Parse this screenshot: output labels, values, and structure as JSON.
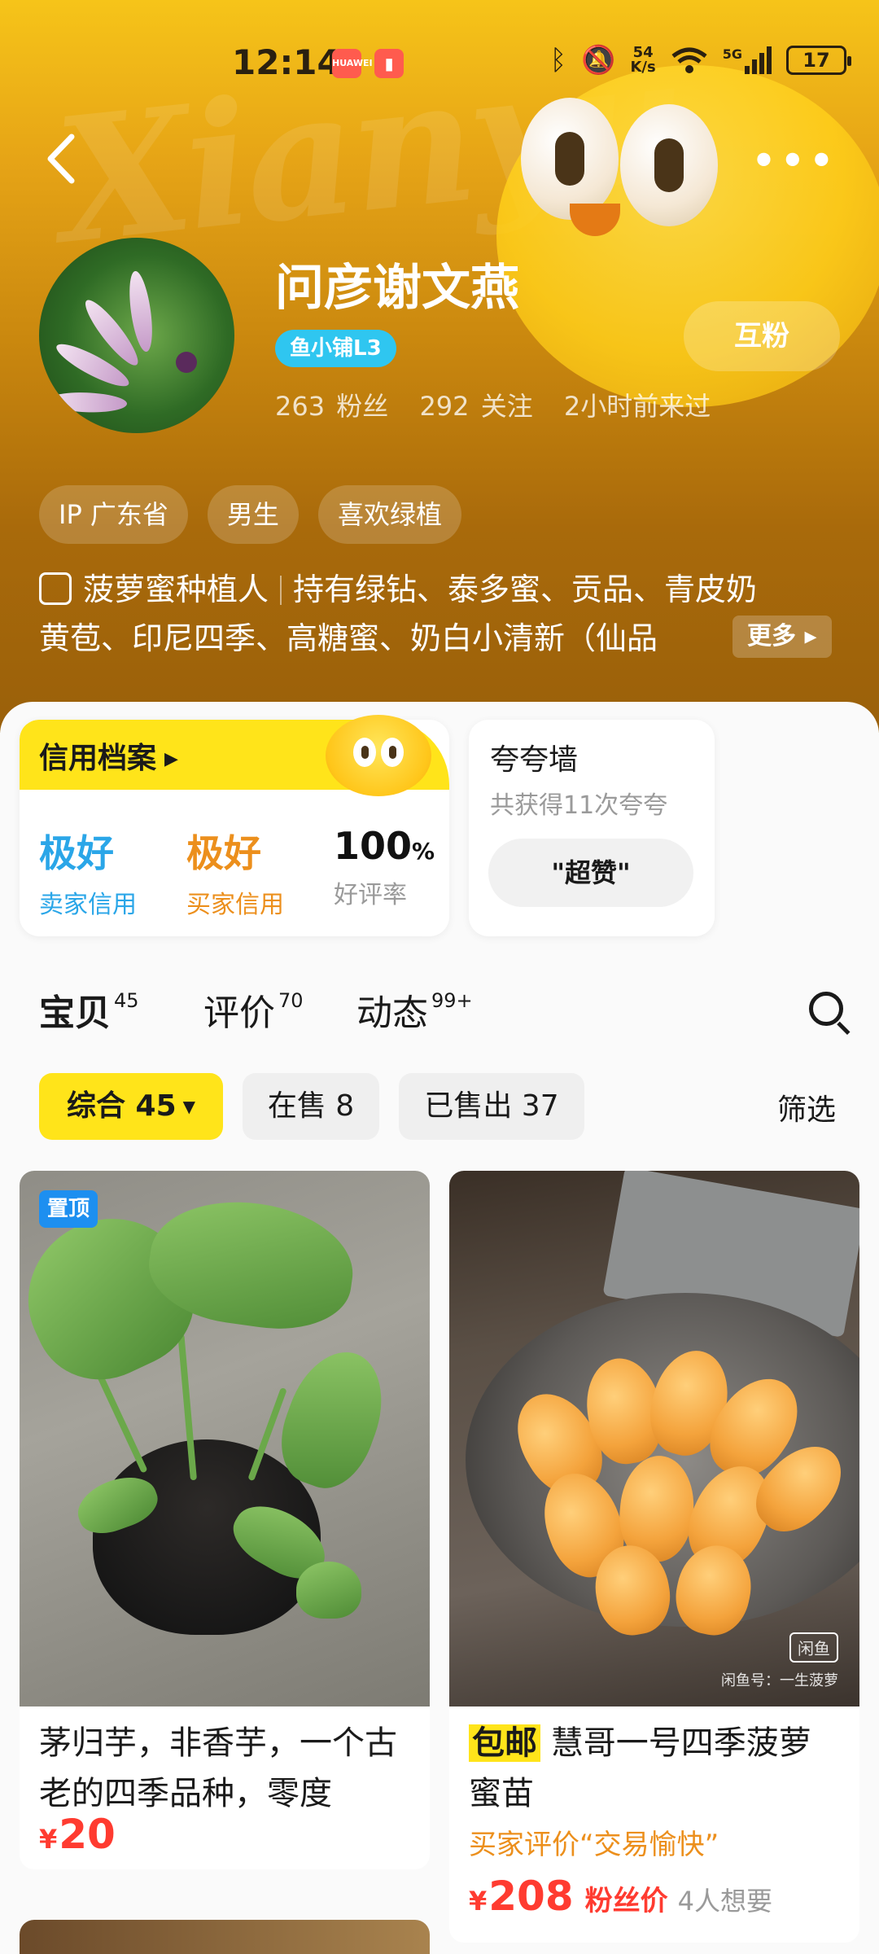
{
  "status_bar": {
    "time": "12:14",
    "net_speed_top": "54",
    "net_speed_bottom": "K/s",
    "battery": "17",
    "icons": [
      "huawei-icon",
      "battery-saver-icon",
      "bluetooth-icon",
      "mute-icon",
      "wifi-icon",
      "signal-5g-icon"
    ],
    "huawei_label": "HUAWEI",
    "signal_label": "5G"
  },
  "header": {
    "back_icon": "back-arrow-icon",
    "more_icon": "more-dots-icon",
    "watermark": "Xianyu"
  },
  "profile": {
    "name": "问彦谢文燕",
    "level": "鱼小铺L3",
    "fans": "263 粉丝",
    "following": "292 关注",
    "last_seen": "2小时前来过",
    "follow_button": "互粉",
    "chips": [
      "IP 广东省",
      "男生",
      "喜欢绿植"
    ],
    "bio_title": "菠萝蜜种植人",
    "bio_line1_rest": "持有绿钻、泰多蜜、贡品、青皮奶",
    "bio_line2": "黄苞、印尼四季、高糖蜜、奶白小清新（仙品",
    "bio_more": "更多"
  },
  "credit": {
    "title": "信用档案",
    "seller_value": "极好",
    "seller_label": "卖家信用",
    "buyer_value": "极好",
    "buyer_label": "买家信用",
    "rate_value": "100",
    "rate_unit": "%",
    "rate_label": "好评率"
  },
  "praise": {
    "title": "夸夸墙",
    "subtitle": "共获得11次夸夸",
    "pill": "\"超赞\""
  },
  "tabs": [
    {
      "label": "宝贝",
      "count": "45"
    },
    {
      "label": "评价",
      "count": "70"
    },
    {
      "label": "动态",
      "count": "99+"
    }
  ],
  "filters": {
    "all": "综合 45",
    "on_sale": "在售 8",
    "sold": "已售出 37",
    "filter": "筛选"
  },
  "products": [
    {
      "badge": "置顶",
      "title": "茅归芋，非香芋，一个古老的四季品种，零度",
      "price": "20",
      "currency": "¥"
    },
    {
      "tag": "包邮",
      "title": "慧哥一号四季菠萝蜜苗",
      "review": "买家评价“交易愉快”",
      "price": "208",
      "currency": "¥",
      "fans_price": "粉丝价",
      "want": "4人想要",
      "watermark_brand": "闲鱼",
      "watermark_text": "闲鱼号：一生菠萝"
    }
  ],
  "colors": {
    "brand_yellow": "#ffe41a",
    "price_red": "#ff3b30",
    "seller_blue": "#2aa6e8",
    "buyer_orange": "#ec8f1c"
  }
}
